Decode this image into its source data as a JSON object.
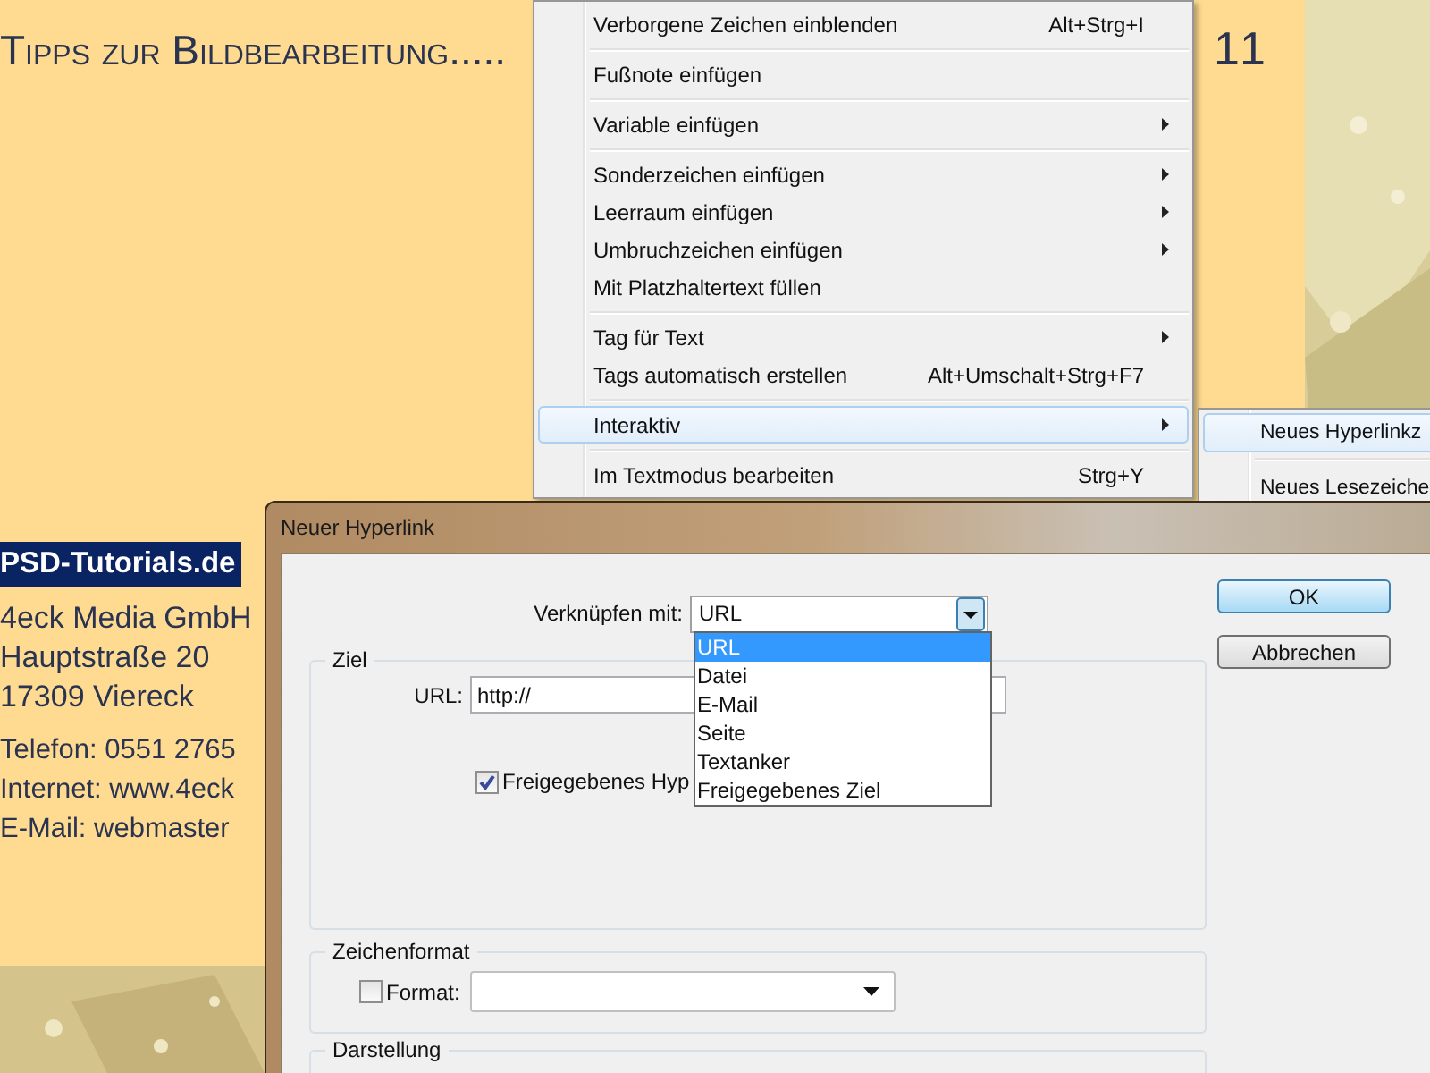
{
  "page": {
    "title": "Tipps zur Bildbearbeitung.....",
    "page_number": "11",
    "highlighted_text": "PSD-Tutorials.de",
    "address_lines": [
      "4eck Media GmbH",
      "Hauptstraße 20",
      "17309 Viereck"
    ],
    "contact_lines": [
      "Telefon: 0551 2765",
      "Internet: www.4eck",
      "E-Mail: webmaster"
    ]
  },
  "context_menu": {
    "items": [
      {
        "kind": "item",
        "label": "Verborgene Zeichen einblenden",
        "shortcut": "Alt+Strg+I",
        "submenu": false,
        "selected": false
      },
      {
        "kind": "separator"
      },
      {
        "kind": "item",
        "label": "Fußnote einfügen",
        "submenu": false,
        "selected": false
      },
      {
        "kind": "separator"
      },
      {
        "kind": "item",
        "label": "Variable einfügen",
        "submenu": true,
        "selected": false
      },
      {
        "kind": "separator"
      },
      {
        "kind": "item",
        "label": "Sonderzeichen einfügen",
        "submenu": true,
        "selected": false
      },
      {
        "kind": "item",
        "label": "Leerraum einfügen",
        "submenu": true,
        "selected": false
      },
      {
        "kind": "item",
        "label": "Umbruchzeichen einfügen",
        "submenu": true,
        "selected": false
      },
      {
        "kind": "item",
        "label": "Mit Platzhaltertext füllen",
        "submenu": false,
        "selected": false
      },
      {
        "kind": "separator"
      },
      {
        "kind": "item",
        "label": "Tag für Text",
        "submenu": true,
        "selected": false
      },
      {
        "kind": "item",
        "label": "Tags automatisch erstellen",
        "shortcut": "Alt+Umschalt+Strg+F7",
        "submenu": false,
        "selected": false
      },
      {
        "kind": "separator"
      },
      {
        "kind": "item",
        "label": "Interaktiv",
        "submenu": true,
        "selected": true
      },
      {
        "kind": "separator"
      },
      {
        "kind": "item",
        "label": "Im Textmodus bearbeiten",
        "shortcut": "Strg+Y",
        "submenu": false,
        "selected": false
      }
    ]
  },
  "submenu": {
    "items": [
      {
        "kind": "item",
        "label": "Neues Hyperlinkz",
        "selected": true
      },
      {
        "kind": "separator"
      },
      {
        "kind": "item",
        "label": "Neues Lesezeiche",
        "selected": false
      }
    ]
  },
  "dialog": {
    "title": "Neuer Hyperlink",
    "link_label": "Verknüpfen mit:",
    "link_value": "URL",
    "link_options": [
      {
        "label": "URL",
        "selected": true
      },
      {
        "label": "Datei",
        "selected": false
      },
      {
        "label": "E-Mail",
        "selected": false
      },
      {
        "label": "Seite",
        "selected": false
      },
      {
        "label": "Textanker",
        "selected": false
      },
      {
        "label": "Freigegebenes Ziel",
        "selected": false
      }
    ],
    "buttons": [
      {
        "label": "OK",
        "default": true
      },
      {
        "label": "Abbrechen",
        "default": false
      }
    ],
    "target_group": {
      "title": "Ziel",
      "url_label": "URL:",
      "url_value": "http://",
      "shared_checkbox": {
        "label": "Freigegebenes Hyp",
        "checked": true
      }
    },
    "format_group": {
      "title": "Zeichenformat",
      "checkbox": {
        "label": "Format:",
        "checked": false
      }
    },
    "display_group": {
      "title": "Darstellung"
    }
  }
}
